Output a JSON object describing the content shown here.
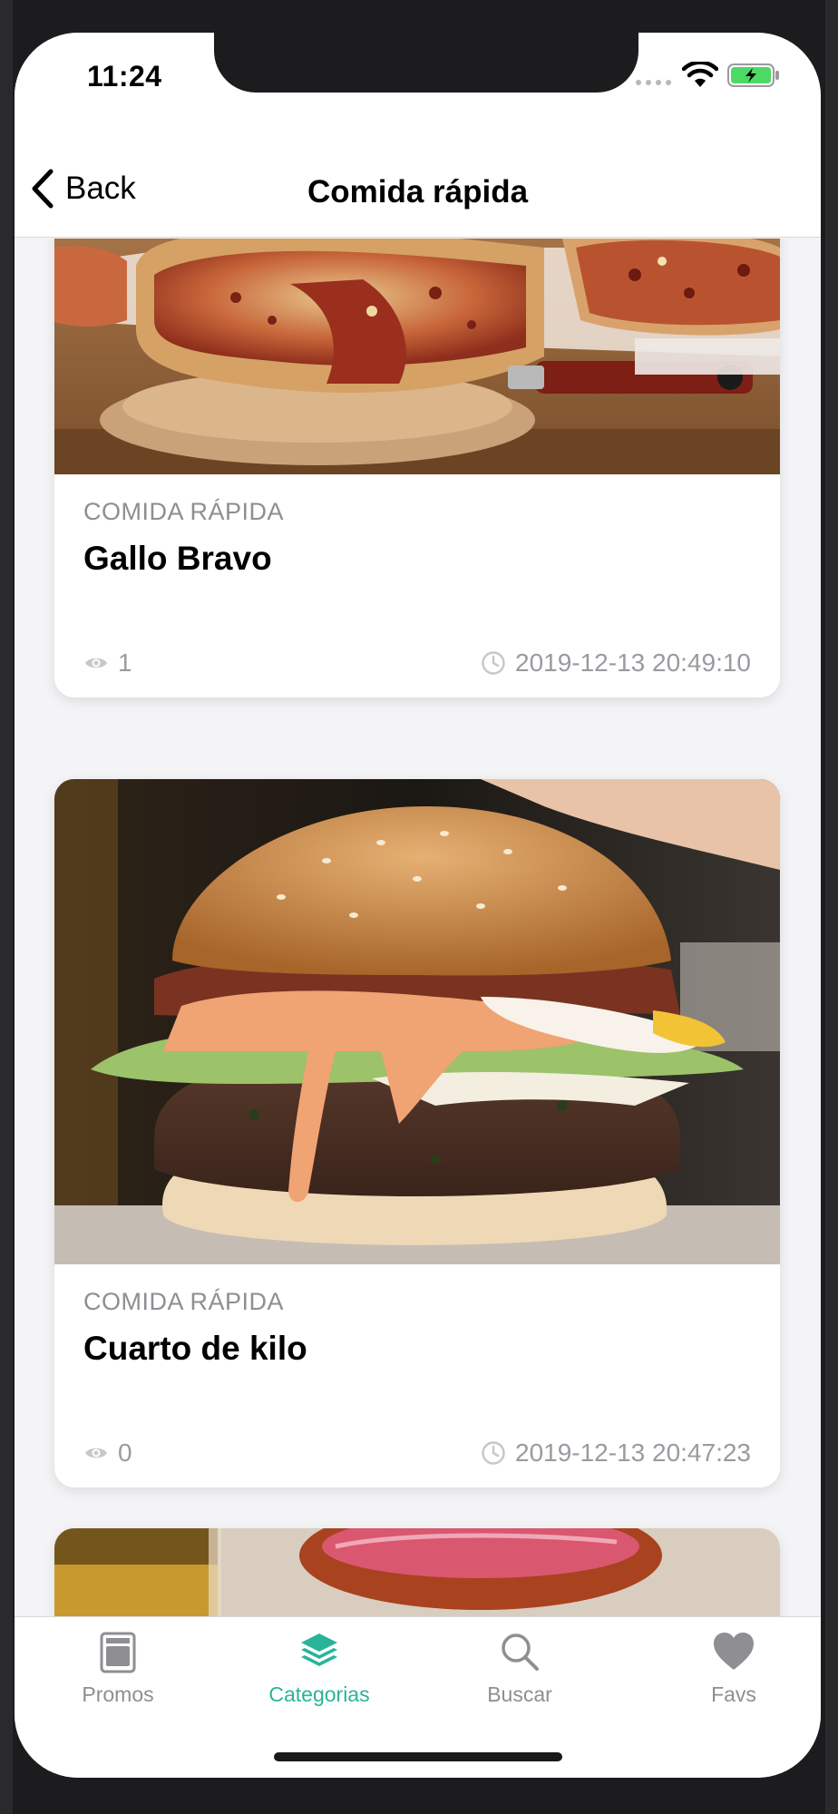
{
  "status": {
    "time": "11:24"
  },
  "nav": {
    "back_label": "Back",
    "title": "Comida rápida"
  },
  "cards": [
    {
      "category": "COMIDA RÁPIDA",
      "title": "Gallo Bravo",
      "views": "1",
      "datetime": "2019-12-13 20:49:10",
      "image_desc": "pizza"
    },
    {
      "category": "COMIDA RÁPIDA",
      "title": "Cuarto de kilo",
      "views": "0",
      "datetime": "2019-12-13 20:47:23",
      "image_desc": "burger"
    }
  ],
  "tabs": [
    {
      "label": "Promos",
      "icon": "promos-icon",
      "active": false
    },
    {
      "label": "Categorias",
      "icon": "layers-icon",
      "active": true
    },
    {
      "label": "Buscar",
      "icon": "search-icon",
      "active": false
    },
    {
      "label": "Favs",
      "icon": "heart-icon",
      "active": false
    }
  ],
  "colors": {
    "accent": "#2ab39b",
    "inactive": "#8e8e93"
  }
}
